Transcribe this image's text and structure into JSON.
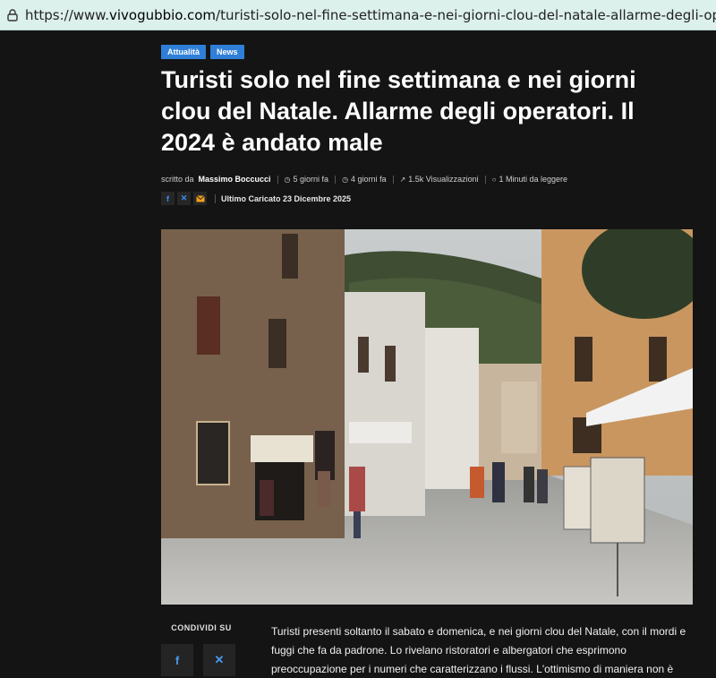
{
  "browser": {
    "url_prefix": "https://www.",
    "url_domain": "vivogubbio.com",
    "url_path": "/turisti-solo-nel-fine-settimana-e-nei-giorni-clou-del-natale-allarme-degli-oper"
  },
  "article": {
    "categories": [
      "Attualità",
      "News"
    ],
    "title": "Turisti solo nel fine settimana e nei giorni clou del Natale. Allarme degli operatori. Il 2024 è andato male",
    "written_by_label": "scritto da",
    "author": "Massimo Boccucci",
    "published": "5 giorni fa",
    "modified": "4 giorni fa",
    "views": "1.5k Visualizzazioni",
    "read_time": "1 Minuti da leggere",
    "last_updated": "Ultimo Caricato 23 Dicembre 2025",
    "share_label": "CONDIVIDI SU",
    "body": "Turisti presenti soltanto il sabato e domenica, e nei giorni clou del Natale, con il mordi e fuggi che fa da padrone. Lo rivelano ristoratori e albergatori che esprimono preoccupazione per i numeri che caratterizzano i flussi. L'ottimismo di maniera non è"
  },
  "colors": {
    "badge": "#2f7fd8",
    "background": "#141414",
    "urlbar": "#dcf0ec"
  },
  "icons": {
    "lock": "lock-icon",
    "clock": "clock-icon",
    "views": "trend-icon",
    "read": "timer-icon",
    "facebook": "facebook-icon",
    "x": "x-icon",
    "mail": "mail-icon"
  }
}
